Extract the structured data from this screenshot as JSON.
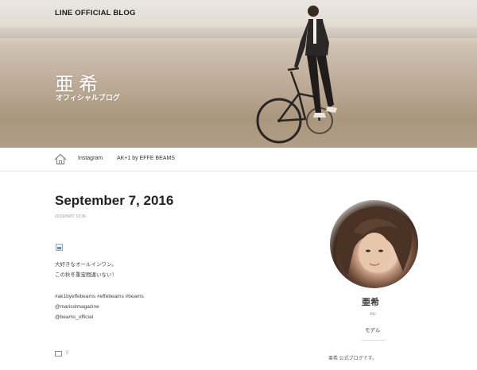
{
  "header": {
    "logo": "LINE OFFICIAL BLOG",
    "blog_title": "亜希",
    "blog_subtitle": "オフィシャルブログ"
  },
  "nav": {
    "home_icon": "home-icon",
    "items": [
      {
        "label": "Instagram"
      },
      {
        "label": "AK+1 by EFFE BEAMS"
      }
    ]
  },
  "post": {
    "title": "September 7, 2016",
    "datetime": "2016/09/07 10:36",
    "lines": [
      "大好きなオールインワン。",
      "この秋冬重宝間違いない！",
      "",
      "#ak1byeffebeams #effebeams #beams",
      "@marisolmagazine",
      "@beams_official"
    ],
    "comment_count": "0"
  },
  "sidebar": {
    "name": "亜希",
    "roman": "Aki",
    "role": "モデル",
    "description": "亜希 公式ブログです。"
  },
  "colors": {
    "banner_sand": "#bba995",
    "text": "#333333"
  }
}
